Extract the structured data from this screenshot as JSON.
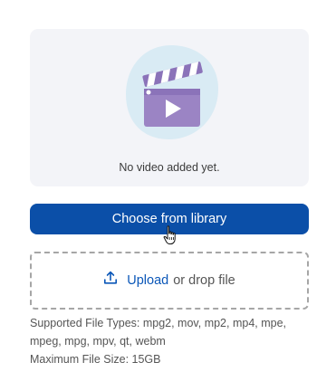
{
  "preview": {
    "empty_text": "No video added yet.",
    "illustration_icon": "clapperboard-play-icon"
  },
  "actions": {
    "choose_label": "Choose from library"
  },
  "dropzone": {
    "icon": "upload-icon",
    "upload_link": "Upload",
    "drop_text": "or drop file"
  },
  "info": {
    "types_line_1": "Supported File Types: mpg2, mov, mp2, mp4, mpe,",
    "types_line_2": "mpeg, mpg, mpv, qt, webm",
    "max_size": "Maximum File Size: 15GB"
  },
  "colors": {
    "primary": "#0b4fa8",
    "link": "#0b57b8",
    "preview_bg": "#f3f4f8",
    "illustration_purple": "#9b84c4",
    "illustration_blob": "#d9ebf4"
  }
}
